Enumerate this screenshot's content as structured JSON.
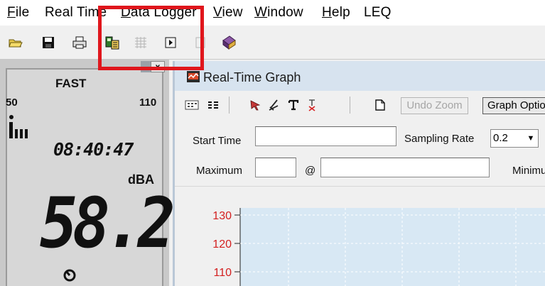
{
  "menu": {
    "items": [
      {
        "key": "file",
        "acc": "F",
        "rest": "ile"
      },
      {
        "key": "realtime",
        "acc": "",
        "rest": "Real Time"
      },
      {
        "key": "datalogger",
        "acc": "D",
        "rest": "ata Logger"
      },
      {
        "key": "view",
        "acc": "V",
        "rest": "iew"
      },
      {
        "key": "window",
        "acc": "W",
        "rest": "indow"
      },
      {
        "key": "help",
        "acc": "H",
        "rest": "elp"
      },
      {
        "key": "leq",
        "acc": "",
        "rest": "LEQ"
      }
    ]
  },
  "toolbar": {
    "buttons": [
      "open-folder-icon",
      "save-icon",
      "print-icon",
      "data-logger-download-icon",
      "grid-disabled-icon",
      "play-icon",
      "blank-disabled-icon",
      "book-icon"
    ]
  },
  "meter": {
    "mode": "FAST",
    "range_low": "50",
    "range_high": "110",
    "time": "08:40:47",
    "unit": "dBA",
    "value": "58.2",
    "close_label": "x"
  },
  "graph": {
    "title": "Real-Time Graph",
    "undo_zoom_label": "Undo Zoom",
    "graph_options_label": "Graph Optio",
    "start_time_label": "Start Time",
    "start_time_value": "",
    "sampling_rate_label": "Sampling Rate",
    "sampling_rate_value": "0.2",
    "maximum_label": "Maximum",
    "maximum_value": "",
    "at_label": "@",
    "at_value": "",
    "minimum_label": "Minimu"
  },
  "colors": {
    "highlight": "#e0161c",
    "axis_label": "#d32020",
    "plot_bg": "#d8e8f4"
  },
  "chart_data": {
    "type": "line",
    "y_ticks": [
      130,
      120,
      110
    ],
    "ylim_visible": [
      110,
      130
    ],
    "grid": true,
    "series": []
  }
}
